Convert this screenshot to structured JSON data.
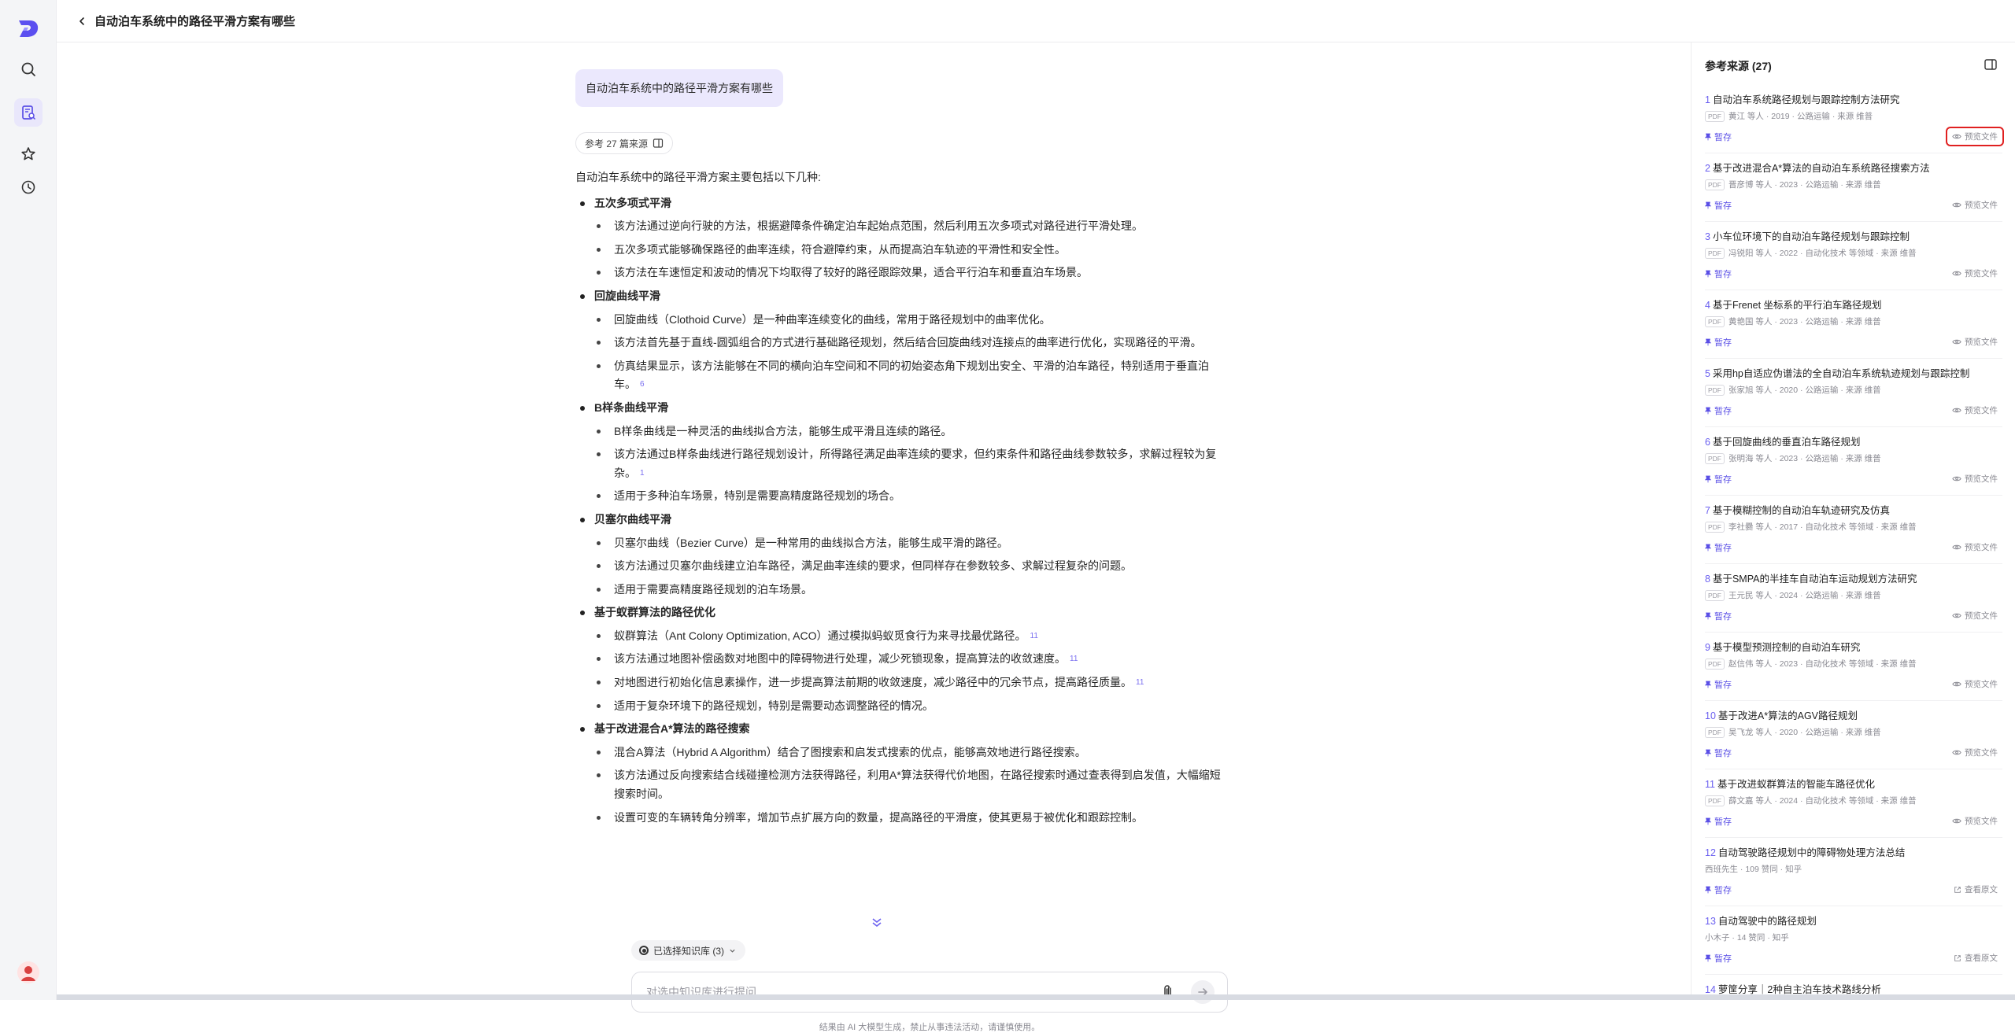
{
  "topbar": {
    "title": "自动泊车系统中的路径平滑方案有哪些"
  },
  "question": "自动泊车系统中的路径平滑方案有哪些",
  "ref_pill": {
    "label": "参考 27 篇来源"
  },
  "answer": {
    "intro": "自动泊车系统中的路径平滑方案主要包括以下几种:",
    "sections": [
      {
        "title": "五次多项式平滑",
        "bullets": [
          {
            "text": "该方法通过逆向行驶的方法，根据避障条件确定泊车起始点范围，然后利用五次多项式对路径进行平滑处理。",
            "cite": ""
          },
          {
            "text": "五次多项式能够确保路径的曲率连续，符合避障约束，从而提高泊车轨迹的平滑性和安全性。",
            "cite": ""
          },
          {
            "text": "该方法在车速恒定和波动的情况下均取得了较好的路径跟踪效果，适合平行泊车和垂直泊车场景。",
            "cite": ""
          }
        ]
      },
      {
        "title": "回旋曲线平滑",
        "bullets": [
          {
            "text": "回旋曲线（Clothoid Curve）是一种曲率连续变化的曲线，常用于路径规划中的曲率优化。",
            "cite": ""
          },
          {
            "text": "该方法首先基于直线-圆弧组合的方式进行基础路径规划，然后结合回旋曲线对连接点的曲率进行优化，实现路径的平滑。",
            "cite": ""
          },
          {
            "text": "仿真结果显示，该方法能够在不同的横向泊车空间和不同的初始姿态角下规划出安全、平滑的泊车路径，特别适用于垂直泊车。",
            "cite": "6"
          }
        ]
      },
      {
        "title": "B样条曲线平滑",
        "bullets": [
          {
            "text": "B样条曲线是一种灵活的曲线拟合方法，能够生成平滑且连续的路径。",
            "cite": ""
          },
          {
            "text": "该方法通过B样条曲线进行路径规划设计，所得路径满足曲率连续的要求，但约束条件和路径曲线参数较多，求解过程较为复杂。",
            "cite": "1"
          },
          {
            "text": "适用于多种泊车场景，特别是需要高精度路径规划的场合。",
            "cite": ""
          }
        ]
      },
      {
        "title": "贝塞尔曲线平滑",
        "bullets": [
          {
            "text": "贝塞尔曲线（Bezier Curve）是一种常用的曲线拟合方法，能够生成平滑的路径。",
            "cite": ""
          },
          {
            "text": "该方法通过贝塞尔曲线建立泊车路径，满足曲率连续的要求，但同样存在参数较多、求解过程复杂的问题。",
            "cite": ""
          },
          {
            "text": "适用于需要高精度路径规划的泊车场景。",
            "cite": ""
          }
        ]
      },
      {
        "title": "基于蚁群算法的路径优化",
        "bullets": [
          {
            "text": "蚁群算法（Ant Colony Optimization, ACO）通过模拟蚂蚁觅食行为来寻找最优路径。",
            "cite": "11"
          },
          {
            "text": "该方法通过地图补偿函数对地图中的障碍物进行处理，减少死锁现象，提高算法的收敛速度。",
            "cite": "11"
          },
          {
            "text": "对地图进行初始化信息素操作，进一步提高算法前期的收敛速度，减少路径中的冗余节点，提高路径质量。",
            "cite": "11"
          },
          {
            "text": "适用于复杂环境下的路径规划，特别是需要动态调整路径的情况。",
            "cite": ""
          }
        ]
      },
      {
        "title": "基于改进混合A*算法的路径搜索",
        "bullets": [
          {
            "text": "混合A算法（Hybrid A Algorithm）结合了图搜索和启发式搜索的优点，能够高效地进行路径搜索。",
            "cite": ""
          },
          {
            "text": "该方法通过反向搜索结合线碰撞检测方法获得路径，利用A*算法获得代价地图，在路径搜索时通过查表得到启发值，大幅缩短搜索时间。",
            "cite": ""
          },
          {
            "text": "设置可变的车辆转角分辨率，增加节点扩展方向的数量，提高路径的平滑度，使其更易于被优化和跟踪控制。",
            "cite": ""
          }
        ]
      }
    ]
  },
  "composer": {
    "kb_chip": "已选择知识库 (3)",
    "placeholder": "对选中知识库进行提问...",
    "disclaimer": "结果由 AI 大模型生成，禁止从事违法活动，请谨慎使用。"
  },
  "refs": {
    "header": "参考来源 (27)",
    "save_label": "暂存",
    "items": [
      {
        "num": "1",
        "title": "自动泊车系统路径规划与跟踪控制方法研究",
        "pdf": "PDF",
        "meta": "黄江 等人 · 2019 · 公路运输 · 来源 维普",
        "action": "预览文件"
      },
      {
        "num": "2",
        "title": "基于改进混合A*算法的自动泊车系统路径搜索方法",
        "pdf": "PDF",
        "meta": "晋彦博 等人 · 2023 · 公路运输 · 来源 维普",
        "action": "预览文件"
      },
      {
        "num": "3",
        "title": "小车位环境下的自动泊车路径规划与跟踪控制",
        "pdf": "PDF",
        "meta": "冯锐阳 等人 · 2022 · 自动化技术 等领域 · 来源 维普",
        "action": "预览文件"
      },
      {
        "num": "4",
        "title": "基于Frenet 坐标系的平行泊车路径规划",
        "pdf": "PDF",
        "meta": "黄艳国 等人 · 2023 · 公路运输 · 来源 维普",
        "action": "预览文件"
      },
      {
        "num": "5",
        "title": "采用hp自适应伪谱法的全自动泊车系统轨迹规划与跟踪控制",
        "pdf": "PDF",
        "meta": "张家旭 等人 · 2020 · 公路运输 · 来源 维普",
        "action": "预览文件"
      },
      {
        "num": "6",
        "title": "基于回旋曲线的垂直泊车路径规划",
        "pdf": "PDF",
        "meta": "张明海 等人 · 2023 · 公路运输 · 来源 维普",
        "action": "预览文件"
      },
      {
        "num": "7",
        "title": "基于模糊控制的自动泊车轨迹研究及仿真",
        "pdf": "PDF",
        "meta": "李社爨 等人 · 2017 · 自动化技术 等领域 · 来源 维普",
        "action": "预览文件"
      },
      {
        "num": "8",
        "title": "基于SMPA的半挂车自动泊车运动规划方法研究",
        "pdf": "PDF",
        "meta": "王元民 等人 · 2024 · 公路运输 · 来源 维普",
        "action": "预览文件"
      },
      {
        "num": "9",
        "title": "基于模型预测控制的自动泊车研究",
        "pdf": "PDF",
        "meta": "赵信伟 等人 · 2023 · 自动化技术 等领域 · 来源 维普",
        "action": "预览文件"
      },
      {
        "num": "10",
        "title": "基于改进A*算法的AGV路径规划",
        "pdf": "PDF",
        "meta": "吴飞龙 等人 · 2020 · 公路运输 · 来源 维普",
        "action": "预览文件"
      },
      {
        "num": "11",
        "title": "基于改进蚁群算法的智能车路径优化",
        "pdf": "PDF",
        "meta": "薛文嘉 等人 · 2024 · 自动化技术 等领域 · 来源 维普",
        "action": "预览文件"
      },
      {
        "num": "12",
        "title": "自动驾驶路径规划中的障碍物处理方法总结",
        "pdf": "",
        "meta": "西班先生 · 109 赞同 · 知乎",
        "action": "查看原文"
      },
      {
        "num": "13",
        "title": "自动驾驶中的路径规划",
        "pdf": "",
        "meta": "小木子 · 14 赞同 · 知乎",
        "action": "查看原文"
      },
      {
        "num": "14",
        "title": "萝筐分享｜2种自主泊车技术路线分析",
        "pdf": "",
        "meta": "",
        "action": ""
      }
    ]
  },
  "colors": {
    "accent": "#5a4fe6",
    "highlight": "#e02020",
    "question_bg": "#ebe8fd"
  }
}
